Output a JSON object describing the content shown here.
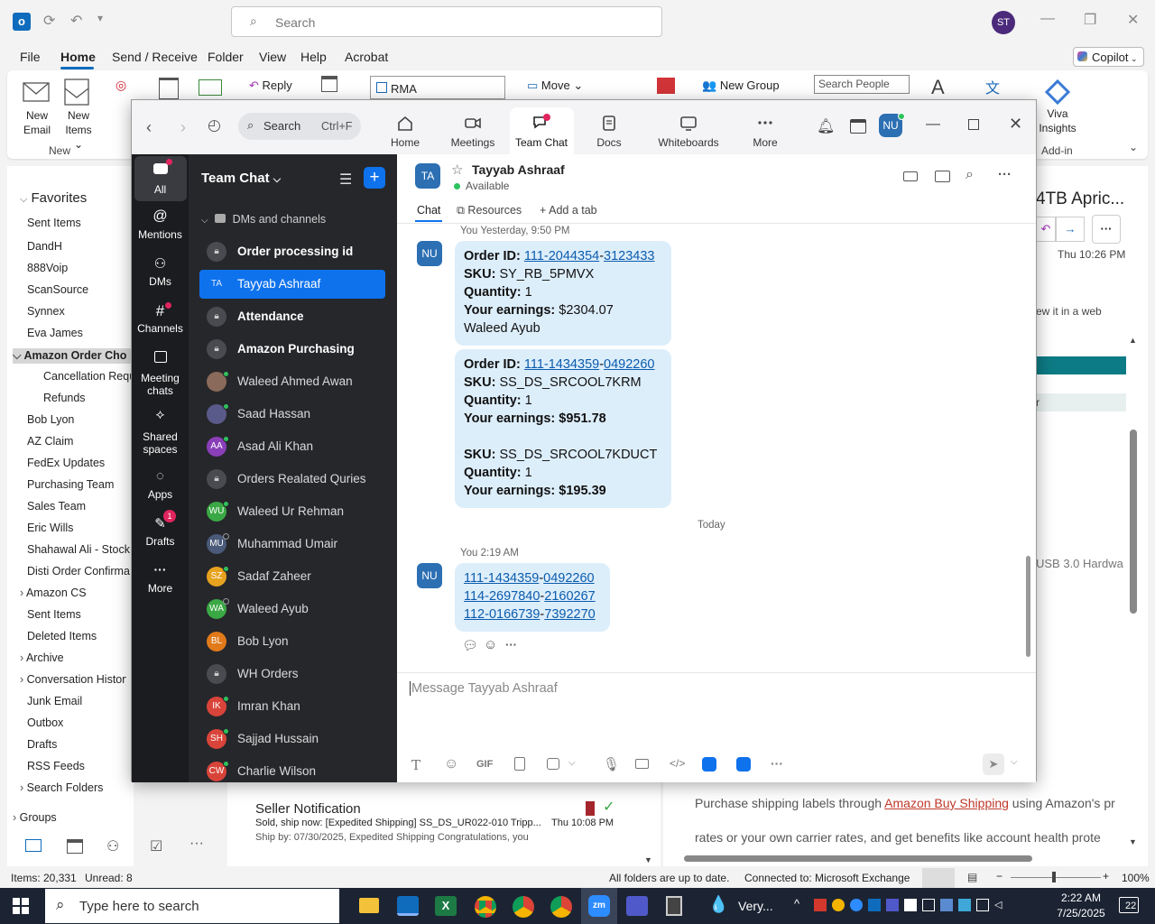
{
  "outlook": {
    "search_placeholder": "Search",
    "user_initials": "ST",
    "menu": [
      "File",
      "Home",
      "Send / Receive",
      "Folder",
      "View",
      "Help",
      "Acrobat"
    ],
    "copilot": "Copilot",
    "ribbon": {
      "new_email": "New Email",
      "new_email_l1": "New",
      "new_email_l2": "Email",
      "new_items_l1": "New",
      "new_items_l2": "Items",
      "group_new": "New",
      "reply": "Reply",
      "rma": "RMA",
      "move": "Move",
      "new_group": "New Group",
      "search_people": "Search People",
      "viva_l1": "Viva",
      "viva_l2": "Insights",
      "group_addin": "Add-in"
    },
    "favorites_label": "Favorites",
    "folders": [
      {
        "label": "Sent Items",
        "indent": 0
      },
      {
        "label": "DandH",
        "indent": 0
      },
      {
        "label": "888Voip",
        "indent": 0
      },
      {
        "label": "ScanSource",
        "indent": 0
      },
      {
        "label": "Synnex",
        "indent": 0
      },
      {
        "label": "Eva James",
        "indent": 0
      },
      {
        "label": "Amazon Order Cho",
        "indent": 0,
        "expanded": true,
        "selected": true
      },
      {
        "label": "Cancellation Requ",
        "indent": 1
      },
      {
        "label": "Refunds",
        "indent": 1
      },
      {
        "label": "Bob Lyon",
        "indent": 0
      },
      {
        "label": "AZ Claim",
        "indent": 0
      },
      {
        "label": "FedEx Updates",
        "indent": 0
      },
      {
        "label": "Purchasing Team",
        "indent": 0
      },
      {
        "label": "Sales Team",
        "indent": 0
      },
      {
        "label": "Eric Wills",
        "indent": 0
      },
      {
        "label": "Shahawal Ali - Stock",
        "indent": 0
      },
      {
        "label": "Disti Order Confirma",
        "indent": 0
      },
      {
        "label": "Amazon CS",
        "indent": 0,
        "collapsed": true
      },
      {
        "label": "Sent Items",
        "indent": 0
      },
      {
        "label": "Deleted Items",
        "indent": 0
      },
      {
        "label": "Archive",
        "indent": 0,
        "collapsed": true
      },
      {
        "label": "Conversation History",
        "indent": 0,
        "collapsed": true
      },
      {
        "label": "Junk Email",
        "indent": 0
      },
      {
        "label": "Outbox",
        "indent": 0
      },
      {
        "label": "Drafts",
        "indent": 0
      },
      {
        "label": "RSS Feeds",
        "indent": 0
      },
      {
        "label": "Search Folders",
        "indent": 0,
        "collapsed": true
      }
    ],
    "groups_label": "Groups",
    "reading": {
      "title": "4TB Apric...",
      "time": "Thu 10:26 PM",
      "web_note": "ew it in a web",
      "r_letter": "r",
      "usb": "USB 3.0 Hardwa",
      "shipping_pre": "Purchase shipping labels through ",
      "shipping_link": "Amazon Buy Shipping",
      "shipping_post": " using Amazon's pr",
      "shipping_line2": "rates or your own carrier rates, and get benefits like account health prote"
    },
    "message": {
      "sender": "Seller Notification",
      "subject": "Sold, ship now: [Expedited Shipping] SS_DS_UR022-010 Tripp...",
      "time": "Thu 10:08 PM",
      "preview": "Ship by: 07/30/2025, Expedited Shipping  Congratulations, you"
    },
    "status": {
      "items": "Items: 20,331",
      "unread": "Unread: 8",
      "sync": "All folders are up to date.",
      "connection": "Connected to: Microsoft Exchange",
      "zoom": "100%"
    }
  },
  "zoom": {
    "search_label": "Search",
    "search_shortcut": "Ctrl+F",
    "tabs": [
      {
        "label": "Home",
        "icon": "home-icon"
      },
      {
        "label": "Meetings",
        "icon": "video-icon"
      },
      {
        "label": "Team Chat",
        "icon": "chat-icon",
        "active": true
      },
      {
        "label": "Docs",
        "icon": "docs-icon"
      },
      {
        "label": "Whiteboards",
        "icon": "whiteboard-icon"
      },
      {
        "label": "More",
        "icon": "more-icon"
      }
    ],
    "user_initials": "NU",
    "nav": [
      {
        "label": "All",
        "icon": "chat-bubble-icon"
      },
      {
        "label": "Mentions",
        "icon": "at-icon"
      },
      {
        "label": "DMs",
        "icon": "people-icon"
      },
      {
        "label": "Channels",
        "icon": "hash-icon"
      },
      {
        "label": "Meeting chats",
        "l1": "Meeting",
        "l2": "chats",
        "icon": "calendar-chat-icon"
      },
      {
        "label": "Shared spaces",
        "l1": "Shared",
        "l2": "spaces",
        "icon": "shared-icon"
      },
      {
        "label": "Apps",
        "icon": "apps-icon"
      },
      {
        "label": "Drafts",
        "icon": "drafts-icon",
        "badge": "1"
      },
      {
        "label": "More",
        "icon": "more-icon"
      }
    ],
    "list_title": "Team Chat",
    "section": "DMs and channels",
    "chats": [
      {
        "name": "Order processing id",
        "type": "lock",
        "bold": true
      },
      {
        "name": "Tayyab Ashraaf",
        "initials": "TA",
        "color": "#2c6fb3",
        "selected": true
      },
      {
        "name": "Attendance",
        "type": "lock",
        "bold": true
      },
      {
        "name": "Amazon Purchasing",
        "type": "lock",
        "bold": true
      },
      {
        "name": "Waleed Ahmed Awan",
        "initials": "",
        "color": "#8a6a5a",
        "online": true
      },
      {
        "name": "Saad Hassan",
        "initials": "",
        "color": "#5a5a8a",
        "online": true
      },
      {
        "name": "Asad Ali Khan",
        "initials": "AA",
        "color": "#8a3fb8",
        "online": true
      },
      {
        "name": "Orders Realated Quries",
        "type": "lock"
      },
      {
        "name": "Waleed Ur Rehman",
        "initials": "WU",
        "color": "#3aa845",
        "online": true
      },
      {
        "name": "Muhammad Umair",
        "initials": "MU",
        "color": "#4a5a78",
        "online": false
      },
      {
        "name": "Sadaf Zaheer",
        "initials": "SZ",
        "color": "#e7a31f",
        "online": true
      },
      {
        "name": "Waleed Ayub",
        "initials": "WA",
        "color": "#3aa845",
        "online": false
      },
      {
        "name": "Bob Lyon",
        "initials": "BL",
        "color": "#e07a1a"
      },
      {
        "name": "WH Orders",
        "type": "lock"
      },
      {
        "name": "Imran Khan",
        "initials": "IK",
        "color": "#d9443a",
        "online": true
      },
      {
        "name": "Sajjad Hussain",
        "initials": "SH",
        "color": "#d9443a",
        "online": true
      },
      {
        "name": "Charlie Wilson",
        "initials": "CW",
        "color": "#d9443a",
        "online": true
      }
    ],
    "header": {
      "initials": "TA",
      "name": "Tayyab Ashraaf",
      "status": "Available",
      "tab_chat": "Chat",
      "tab_resources": "Resources",
      "add_tab": "Add a tab"
    },
    "messages": {
      "meta1": "You Yesterday, 9:50 PM",
      "avatar": "NU",
      "m1": {
        "order_label": "Order ID: ",
        "order_p1": "111-2044354",
        "order_p2": "3123433",
        "sku_label": "SKU: ",
        "sku": "SY_RB_5PMVX",
        "qty_label": "Quantity: ",
        "qty": "1",
        "earn_label": "Your earnings: ",
        "earn": "$2304.07",
        "signature": "Waleed Ayub"
      },
      "m2": {
        "order_label": "Order ID: ",
        "order_p1": "111-1434359",
        "order_p2": "0492260",
        "sku_label": "SKU: ",
        "sku": "SS_DS_SRCOOL7KRM",
        "qty_label": "Quantity: ",
        "qty": "1",
        "earn_label": "Your earnings: ",
        "earn": "$951.78",
        "sku2": "SS_DS_SRCOOL7KDUCT",
        "qty2": "1",
        "earn2": "$195.39"
      },
      "divider": "Today",
      "meta2": "You 2:19 AM",
      "m3": [
        {
          "p1": "111-1434359",
          "p2": "0492260"
        },
        {
          "p1": "114-2697840",
          "p2": "2160267"
        },
        {
          "p1": "112-0166739",
          "p2": "7392270"
        }
      ]
    },
    "composer_placeholder": "Message Tayyab Ashraaf",
    "composer_gif": "GIF"
  },
  "taskbar": {
    "search_placeholder": "Type here to search",
    "weather": "Very...",
    "time": "2:22 AM",
    "date": "7/25/2025",
    "notifications": "22"
  }
}
